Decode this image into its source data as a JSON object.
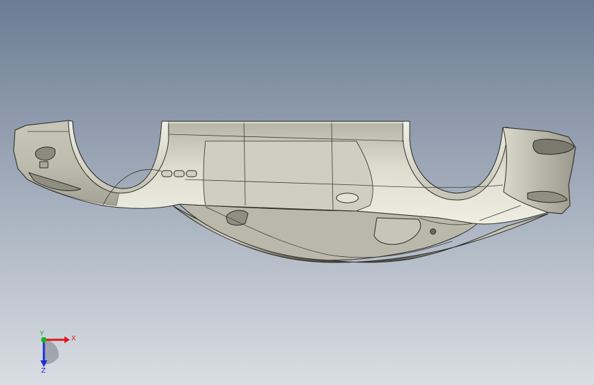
{
  "viewport": {
    "background_top": "#6c7c93",
    "background_bottom": "#d6dbe2",
    "model_colors": {
      "highlight": "#ecebe0",
      "mid": "#c8c7b8",
      "shadow": "#5d5c52",
      "edge": "#2a2a25"
    }
  },
  "triad": {
    "x_label": "X",
    "y_label": "Y",
    "z_label": "Z",
    "x_color": "#e0161b",
    "y_color": "#19b51e",
    "z_color": "#1f2ad8"
  }
}
